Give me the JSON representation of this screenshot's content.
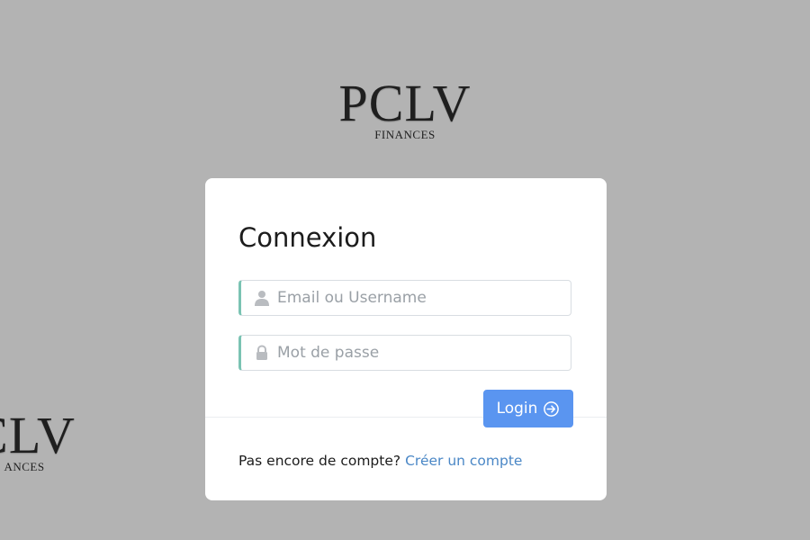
{
  "logo_top": {
    "mark": "PCLV",
    "sub": "FINANCES"
  },
  "logo_bottom": {
    "mark": "CLV",
    "sub": "ANCES"
  },
  "login": {
    "title": "Connexion",
    "username_placeholder": "Email ou Username",
    "password_placeholder": "Mot de passe",
    "submit_label": "Login",
    "prompt": "Pas encore de compte?",
    "create_link": "Créer un compte"
  },
  "colors": {
    "background": "#b3b3b3",
    "card": "#ffffff",
    "accent_border": "#7ac3b3",
    "button": "#5a95f0",
    "link": "#4a87c6"
  },
  "icons": {
    "username": "user-icon",
    "password": "lock-icon",
    "submit": "arrow-circle-right-icon"
  }
}
